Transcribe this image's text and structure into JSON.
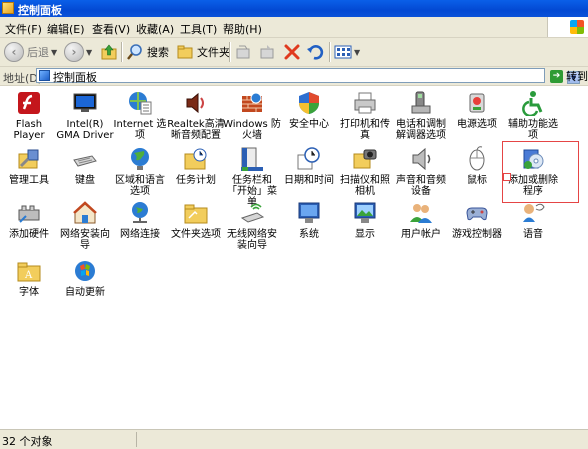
{
  "window": {
    "title": "控制面板"
  },
  "menu": [
    "文件(F)",
    "编辑(E)",
    "查看(V)",
    "收藏(A)",
    "工具(T)",
    "帮助(H)"
  ],
  "toolbar": {
    "back": "后退",
    "search": "搜索",
    "folders": "文件夹"
  },
  "address": {
    "label": "地址(D)",
    "value": "控制面板",
    "go": "转到"
  },
  "items": [
    {
      "label": "Flash Player",
      "icon": "flash-icon"
    },
    {
      "label": "Intel(R) GMA Driver",
      "icon": "monitor-icon"
    },
    {
      "label": "Internet 选项",
      "icon": "internet-options-icon"
    },
    {
      "label": "Realtek高清晰音频配置",
      "icon": "speaker-icon"
    },
    {
      "label": "Windows 防火墙",
      "icon": "firewall-icon"
    },
    {
      "label": "安全中心",
      "icon": "shield-icon"
    },
    {
      "label": "打印机和传真",
      "icon": "printer-icon"
    },
    {
      "label": "电话和调制解调器选项",
      "icon": "phone-icon"
    },
    {
      "label": "电源选项",
      "icon": "power-icon"
    },
    {
      "label": "辅助功能选项",
      "icon": "accessibility-icon"
    },
    {
      "label": "管理工具",
      "icon": "admin-tools-icon"
    },
    {
      "label": "键盘",
      "icon": "keyboard-icon"
    },
    {
      "label": "区域和语言选项",
      "icon": "globe-icon"
    },
    {
      "label": "任务计划",
      "icon": "scheduled-tasks-icon"
    },
    {
      "label": "任务栏和「开始」菜单",
      "icon": "taskbar-icon"
    },
    {
      "label": "日期和时间",
      "icon": "clock-icon"
    },
    {
      "label": "扫描仪和照相机",
      "icon": "scanner-icon"
    },
    {
      "label": "声音和音频设备",
      "icon": "audio-icon"
    },
    {
      "label": "鼠标",
      "icon": "mouse-icon"
    },
    {
      "label": "添加或删除程序",
      "icon": "add-remove-icon"
    },
    {
      "label": "添加硬件",
      "icon": "hardware-icon"
    },
    {
      "label": "网络安装向导",
      "icon": "network-wizard-icon"
    },
    {
      "label": "网络连接",
      "icon": "network-icon"
    },
    {
      "label": "文件夹选项",
      "icon": "folder-options-icon"
    },
    {
      "label": "无线网络安装向导",
      "icon": "wireless-icon"
    },
    {
      "label": "系统",
      "icon": "system-icon"
    },
    {
      "label": "显示",
      "icon": "display-icon"
    },
    {
      "label": "用户帐户",
      "icon": "users-icon"
    },
    {
      "label": "游戏控制器",
      "icon": "gamepad-icon"
    },
    {
      "label": "语音",
      "icon": "speech-icon"
    },
    {
      "label": "字体",
      "icon": "fonts-icon"
    },
    {
      "label": "自动更新",
      "icon": "update-icon"
    }
  ],
  "status": {
    "text": "32 个对象"
  }
}
